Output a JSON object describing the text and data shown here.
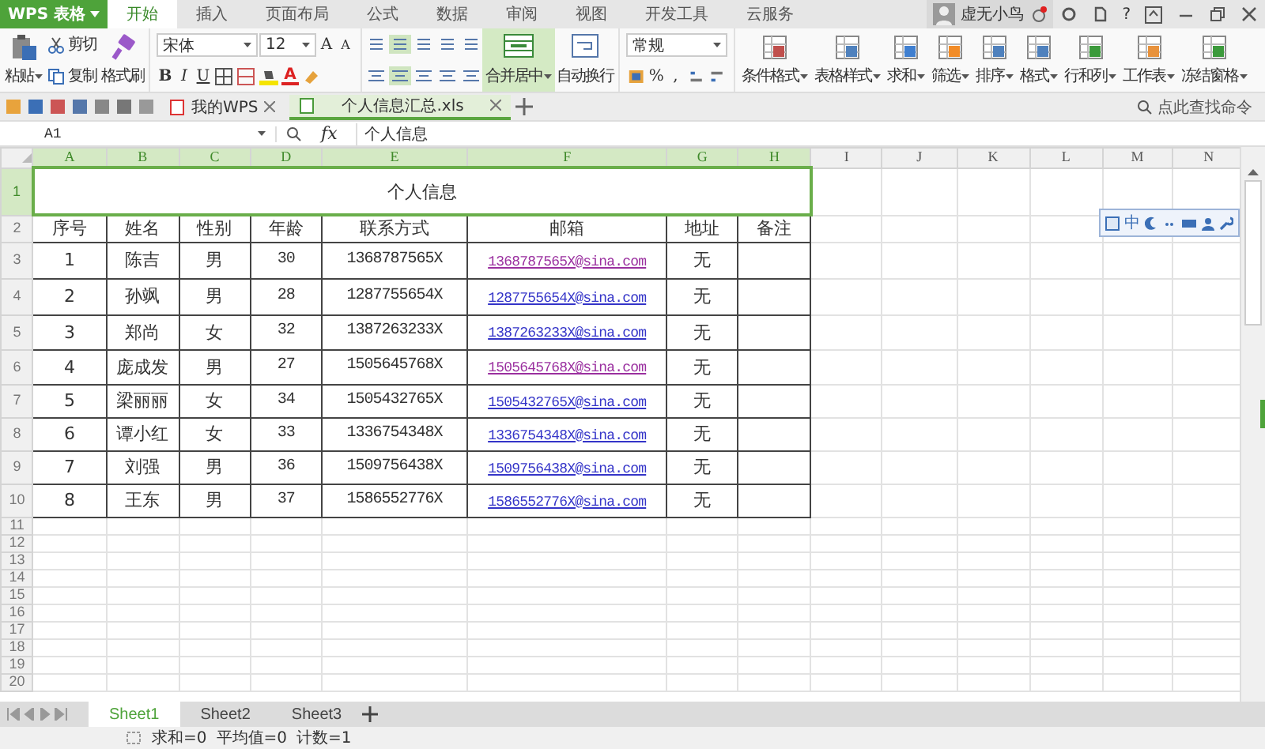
{
  "app": {
    "logo": "WPS 表格"
  },
  "menu_tabs": [
    {
      "label": "开始",
      "selected": true
    },
    {
      "label": "插入",
      "selected": false
    },
    {
      "label": "页面布局",
      "selected": false
    },
    {
      "label": "公式",
      "selected": false
    },
    {
      "label": "数据",
      "selected": false
    },
    {
      "label": "审阅",
      "selected": false
    },
    {
      "label": "视图",
      "selected": false
    },
    {
      "label": "开发工具",
      "selected": false
    },
    {
      "label": "云服务",
      "selected": false
    }
  ],
  "user": {
    "name": "虚无小鸟",
    "help": "?"
  },
  "ribbon": {
    "paste": "粘贴",
    "cut": "剪切",
    "copy": "复制",
    "format_painter": "格式刷",
    "font": "宋体",
    "font_size": "12",
    "grow_font": "A",
    "shrink_font": "A",
    "style_buttons": [
      "B",
      "I",
      "U"
    ],
    "font_color": "A",
    "merge": "合并居中",
    "wrap": "自动换行",
    "number_format": "常规",
    "percent": "%",
    "comma": ",",
    "big_buttons": [
      {
        "label": "条件格式"
      },
      {
        "label": "表格样式"
      },
      {
        "label": "求和"
      },
      {
        "label": "筛选"
      },
      {
        "label": "排序"
      },
      {
        "label": "格式"
      },
      {
        "label": "行和列"
      },
      {
        "label": "工作表"
      },
      {
        "label": "冻结窗格"
      }
    ]
  },
  "doc_tabs": [
    {
      "label": "我的WPS",
      "selected": false
    },
    {
      "label": "个人信息汇总.xls",
      "selected": true
    }
  ],
  "command_search": {
    "placeholder": "点此查找命令"
  },
  "formula_bar": {
    "cell": "A1",
    "fx": "fx",
    "content": "个人信息"
  },
  "sheet": {
    "columns": [
      {
        "label": "A",
        "selected": true
      },
      {
        "label": "B",
        "selected": true
      },
      {
        "label": "C",
        "selected": true
      },
      {
        "label": "D",
        "selected": true
      },
      {
        "label": "E",
        "selected": true
      },
      {
        "label": "F",
        "selected": true
      },
      {
        "label": "G",
        "selected": true
      },
      {
        "label": "H",
        "selected": true
      },
      {
        "label": "I",
        "selected": false
      },
      {
        "label": "J",
        "selected": false
      },
      {
        "label": "K",
        "selected": false
      },
      {
        "label": "L",
        "selected": false
      },
      {
        "label": "M",
        "selected": false
      },
      {
        "label": "N",
        "selected": false
      }
    ],
    "rows": [
      {
        "label": "1",
        "selected": true
      },
      {
        "label": "2",
        "selected": false
      },
      {
        "label": "3",
        "selected": false
      },
      {
        "label": "4",
        "selected": false
      },
      {
        "label": "5",
        "selected": false
      },
      {
        "label": "6",
        "selected": false
      },
      {
        "label": "7",
        "selected": false
      },
      {
        "label": "8",
        "selected": false
      },
      {
        "label": "9",
        "selected": false
      },
      {
        "label": "10",
        "selected": false
      },
      {
        "label": "11",
        "selected": false
      },
      {
        "label": "12",
        "selected": false
      },
      {
        "label": "13",
        "selected": false
      },
      {
        "label": "14",
        "selected": false
      },
      {
        "label": "15",
        "selected": false
      },
      {
        "label": "16",
        "selected": false
      },
      {
        "label": "17",
        "selected": false
      },
      {
        "label": "18",
        "selected": false
      },
      {
        "label": "19",
        "selected": false
      },
      {
        "label": "20",
        "selected": false
      }
    ]
  },
  "table": {
    "title": "个人信息",
    "headers": [
      "序号",
      "姓名",
      "性别",
      "年龄",
      "联系方式",
      "邮箱",
      "地址",
      "备注"
    ],
    "records": [
      {
        "no": "1",
        "name": "陈吉",
        "gender": "男",
        "age": "30",
        "phone": "1368787565X",
        "email": "1368787565X@sina.com",
        "visited": true,
        "address": "无"
      },
      {
        "no": "2",
        "name": "孙飒",
        "gender": "男",
        "age": "28",
        "phone": "1287755654X",
        "email": "1287755654X@sina.com",
        "visited": false,
        "address": "无"
      },
      {
        "no": "3",
        "name": "郑尚",
        "gender": "女",
        "age": "32",
        "phone": "1387263233X",
        "email": "1387263233X@sina.com",
        "visited": false,
        "address": "无"
      },
      {
        "no": "4",
        "name": "庞成发",
        "gender": "男",
        "age": "27",
        "phone": "1505645768X",
        "email": "1505645768X@sina.com",
        "visited": true,
        "address": "无"
      },
      {
        "no": "5",
        "name": "梁丽丽",
        "gender": "女",
        "age": "34",
        "phone": "1505432765X",
        "email": "1505432765X@sina.com",
        "visited": false,
        "address": "无"
      },
      {
        "no": "6",
        "name": "谭小红",
        "gender": "女",
        "age": "33",
        "phone": "1336754348X",
        "email": "1336754348X@sina.com",
        "visited": false,
        "address": "无"
      },
      {
        "no": "7",
        "name": "刘强",
        "gender": "男",
        "age": "36",
        "phone": "1509756438X",
        "email": "1509756438X@sina.com",
        "visited": false,
        "address": "无"
      },
      {
        "no": "8",
        "name": "王东",
        "gender": "男",
        "age": "37",
        "phone": "1586552776X",
        "email": "1586552776X@sina.com",
        "visited": false,
        "address": "无"
      }
    ]
  },
  "ime_toolbar": {
    "label": "中"
  },
  "sheet_tabs": [
    {
      "label": "Sheet1",
      "selected": true
    },
    {
      "label": "Sheet2",
      "selected": false
    },
    {
      "label": "Sheet3",
      "selected": false
    }
  ],
  "status": [
    "求和=0",
    "平均值=0",
    "计数=1"
  ]
}
